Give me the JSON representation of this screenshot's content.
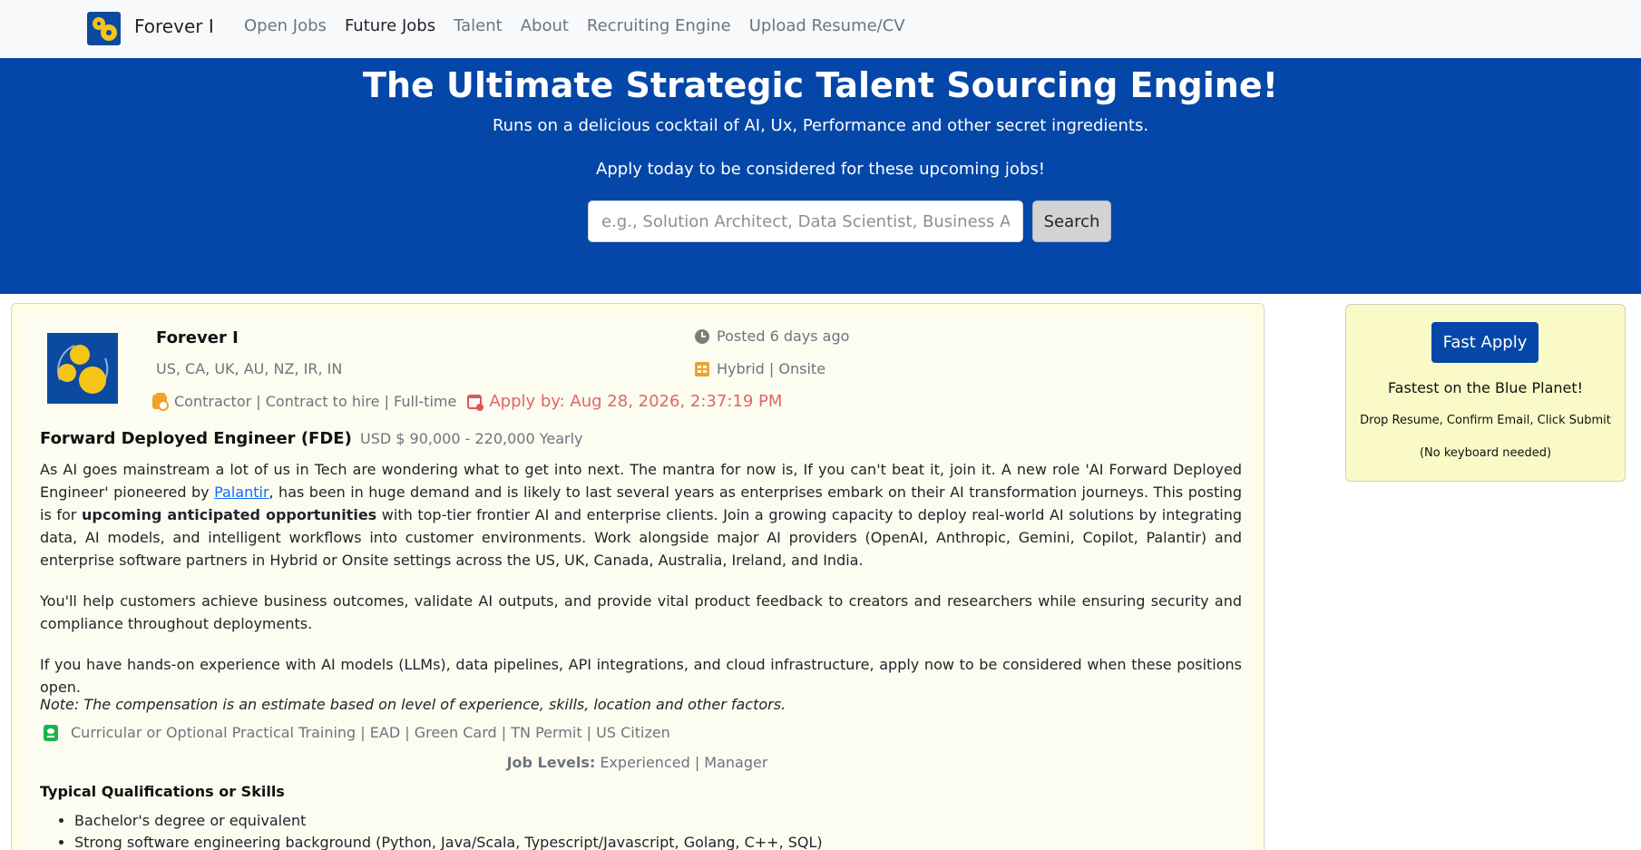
{
  "navbar": {
    "brand": "Forever I",
    "links": [
      "Open Jobs",
      "Future Jobs",
      "Talent",
      "About",
      "Recruiting Engine",
      "Upload Resume/CV"
    ],
    "active_index": 1
  },
  "hero": {
    "title": "The Ultimate Strategic Talent Sourcing Engine!",
    "subtitle": "Runs on a delicious cocktail of AI, Ux, Performance and other secret ingredients.",
    "cta": "Apply today to be considered for these upcoming jobs!",
    "search_placeholder": "e.g., Solution Architect, Data Scientist, Business Analyst",
    "search_button": "Search"
  },
  "job": {
    "company": "Forever I",
    "locations": "US, CA, UK, AU, NZ, IR, IN",
    "posted": "Posted 6 days ago",
    "work_mode": "Hybrid | Onsite",
    "employment_types": "Contractor | Contract to hire | Full-time",
    "apply_by": "Apply by: Aug 28, 2026, 2:37:19 PM",
    "title": "Forward Deployed Engineer (FDE)",
    "salary": "USD $ 90,000 - 220,000 Yearly",
    "para1_a": "As AI goes mainstream a lot of us in Tech are wondering what to get into next. The mantra for now is, If you can't beat it, join it. A new role 'AI Forward Deployed Engineer' pioneered by ",
    "para1_link": "Palantir",
    "para1_b": ", has been in huge demand and is likely to last several years as enterprises embark on their AI transformation journeys. This posting is for ",
    "para1_bold": "upcoming anticipated opportunities",
    "para1_c": " with top-tier frontier AI and enterprise clients. Join a growing capacity to deploy real-world AI solutions by integrating data, AI models, and intelligent workflows into customer environments. Work alongside major AI providers (OpenAI, Anthropic, Gemini, Copilot, Palantir) and enterprise software partners in Hybrid or Onsite settings across the US, UK, Canada, Australia, Ireland, and India.",
    "para2": "You'll help customers achieve business outcomes, validate AI outputs, and provide vital product feedback to creators and researchers while ensuring security and compliance throughout deployments.",
    "para3": "If you have hands-on experience with AI models (LLMs), data pipelines, API integrations, and cloud infrastructure, apply now to be considered when these positions open.",
    "note": "Note: The compensation is an estimate based on level of experience, skills, location and other factors.",
    "work_auth": "Curricular or Optional Practical Training | EAD | Green Card | TN Permit | US Citizen",
    "job_levels_label": "Job Levels:",
    "job_levels": " Experienced | Manager",
    "qualifications_heading": "Typical Qualifications or Skills",
    "qualifications": [
      "Bachelor's degree or equivalent",
      "Strong software engineering background (Python, Java/Scala, Typescript/Javascript, Golang, C++, SQL)"
    ]
  },
  "sidebar": {
    "button": "Fast Apply",
    "line1": "Fastest on the Blue Planet!",
    "line2": "Drop Resume, Confirm Email, Click Submit",
    "line3": "(No keyboard needed)"
  },
  "colors": {
    "hero_blue": "#0447a8",
    "card_bg": "#fdfde4",
    "apply_red": "#e06666",
    "icon_orange": "#f0a22a",
    "icon_green": "#21b04b"
  }
}
